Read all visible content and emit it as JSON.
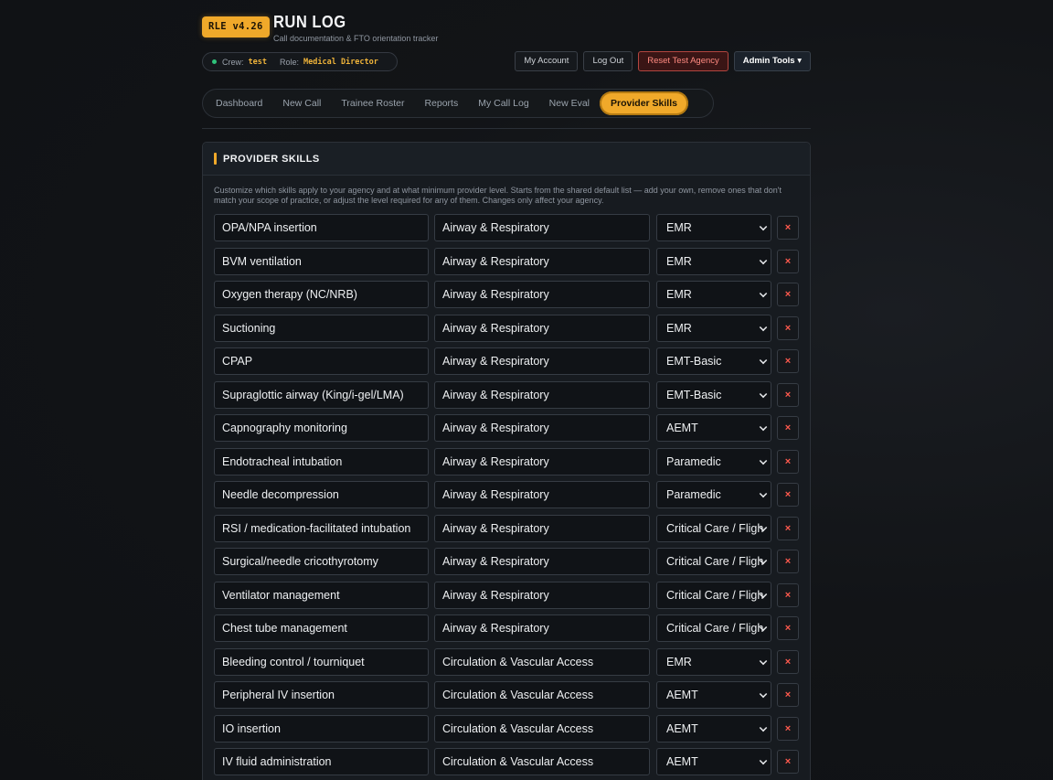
{
  "header": {
    "version": "RLE v4.26",
    "title": "RUN LOG",
    "subtitle": "Call documentation & FTO orientation tracker",
    "crew_label": "Crew:",
    "crew_value": "test",
    "role_label": "Role:",
    "role_value": "Medical Director",
    "status_color": "#2fc27a"
  },
  "top_buttons": {
    "my_account": "My Account",
    "log_out": "Log Out",
    "reset": "Reset Test Agency",
    "admin": "Admin Tools ▾"
  },
  "tabs": [
    "Dashboard",
    "New Call",
    "Trainee Roster",
    "Reports",
    "My Call Log",
    "New Eval",
    "Provider Skills"
  ],
  "active_tab": "Provider Skills",
  "panel": {
    "title": "PROVIDER SKILLS",
    "description": "Customize which skills apply to your agency and at what minimum provider level. Starts from the shared default list — add your own, remove ones that don't match your scope of practice, or adjust the level required for any of them. Changes only affect your agency."
  },
  "delete_glyph": "×",
  "skills": [
    {
      "name": "OPA/NPA insertion",
      "category": "Airway & Respiratory",
      "level": "EMR"
    },
    {
      "name": "BVM ventilation",
      "category": "Airway & Respiratory",
      "level": "EMR"
    },
    {
      "name": "Oxygen therapy (NC/NRB)",
      "category": "Airway & Respiratory",
      "level": "EMR"
    },
    {
      "name": "Suctioning",
      "category": "Airway & Respiratory",
      "level": "EMR"
    },
    {
      "name": "CPAP",
      "category": "Airway & Respiratory",
      "level": "EMT-Basic"
    },
    {
      "name": "Supraglottic airway (King/i-gel/LMA)",
      "category": "Airway & Respiratory",
      "level": "EMT-Basic"
    },
    {
      "name": "Capnography monitoring",
      "category": "Airway & Respiratory",
      "level": "AEMT"
    },
    {
      "name": "Endotracheal intubation",
      "category": "Airway & Respiratory",
      "level": "Paramedic"
    },
    {
      "name": "Needle decompression",
      "category": "Airway & Respiratory",
      "level": "Paramedic"
    },
    {
      "name": "RSI / medication-facilitated intubation",
      "category": "Airway & Respiratory",
      "level": "Critical Care / Fligh"
    },
    {
      "name": "Surgical/needle cricothyrotomy",
      "category": "Airway & Respiratory",
      "level": "Critical Care / Fligh"
    },
    {
      "name": "Ventilator management",
      "category": "Airway & Respiratory",
      "level": "Critical Care / Fligh"
    },
    {
      "name": "Chest tube management",
      "category": "Airway & Respiratory",
      "level": "Critical Care / Fligh"
    },
    {
      "name": "Bleeding control / tourniquet",
      "category": "Circulation & Vascular Access",
      "level": "EMR"
    },
    {
      "name": "Peripheral IV insertion",
      "category": "Circulation & Vascular Access",
      "level": "AEMT"
    },
    {
      "name": "IO insertion",
      "category": "Circulation & Vascular Access",
      "level": "AEMT"
    },
    {
      "name": "IV fluid administration",
      "category": "Circulation & Vascular Access",
      "level": "AEMT"
    }
  ]
}
